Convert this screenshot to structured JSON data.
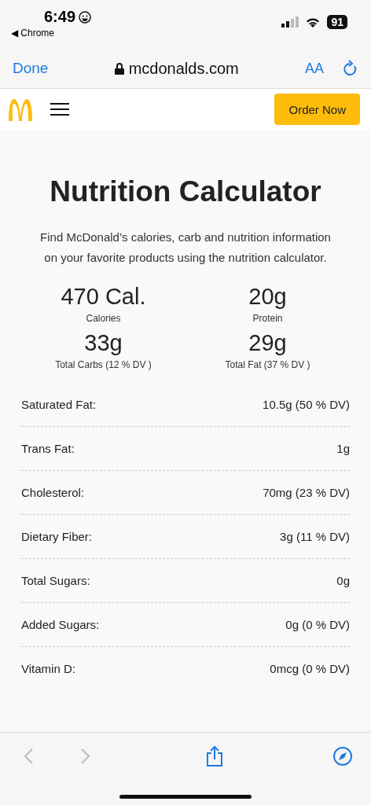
{
  "status_bar": {
    "time": "6:49",
    "back_app": "◀ Chrome",
    "battery": "91"
  },
  "url_bar": {
    "done": "Done",
    "domain": "mcdonalds.com",
    "text_size": "AA"
  },
  "nav": {
    "order_button": "Order Now"
  },
  "page": {
    "title": "Nutrition Calculator",
    "description": "Find McDonald’s calories, carb and nutrition information on your favorite products using the nutrition calculator."
  },
  "stats": [
    {
      "value": "470 Cal.",
      "label": "Calories"
    },
    {
      "value": "20g",
      "label": "Protein"
    },
    {
      "value": "33g",
      "label": "Total Carbs (12 % DV )"
    },
    {
      "value": "29g",
      "label": "Total Fat (37 % DV )"
    }
  ],
  "nutrients": [
    {
      "name": "Saturated Fat:",
      "amount": "10.5g (50 % DV)"
    },
    {
      "name": "Trans Fat:",
      "amount": "1g"
    },
    {
      "name": "Cholesterol:",
      "amount": "70mg (23 % DV)"
    },
    {
      "name": "Dietary Fiber:",
      "amount": "3g (11 % DV)"
    },
    {
      "name": "Total Sugars:",
      "amount": "0g"
    },
    {
      "name": "Added Sugars:",
      "amount": "0g (0 % DV)"
    },
    {
      "name": "Vitamin D:",
      "amount": "0mcg (0 % DV)"
    }
  ],
  "toolbar": {
    "back": {
      "disabled": true
    },
    "forward": {
      "disabled": true
    }
  }
}
